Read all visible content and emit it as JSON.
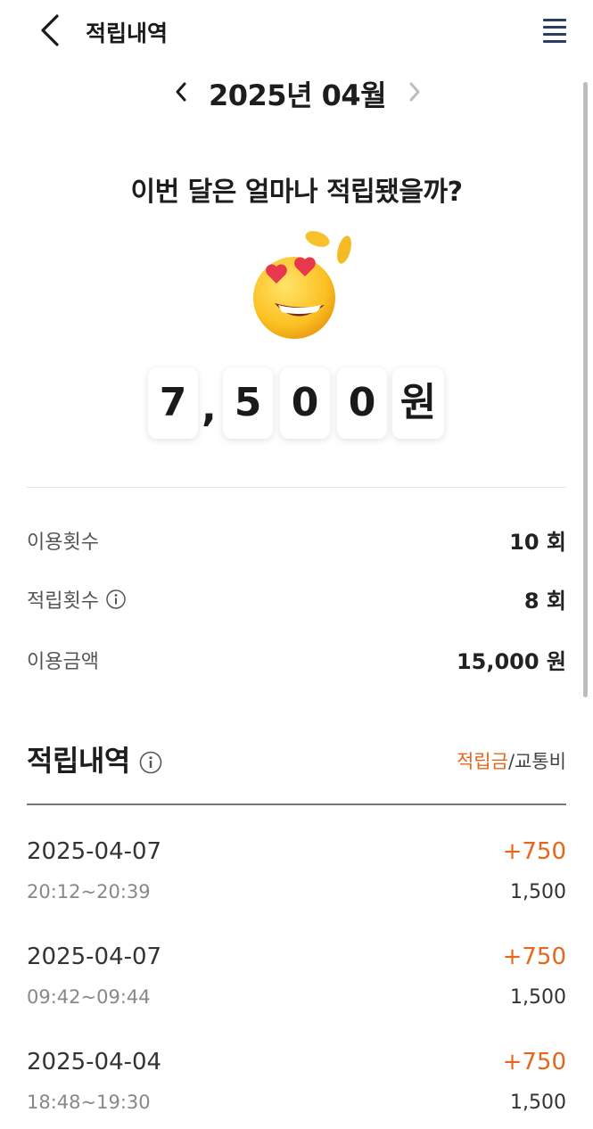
{
  "header": {
    "title": "적립내역",
    "back_icon": "chevron-left-icon",
    "menu_icon": "hamburger-menu-icon"
  },
  "month_nav": {
    "label": "2025년 04월",
    "prev_icon": "chevron-left-icon",
    "next_icon": "chevron-right-icon"
  },
  "summary": {
    "question": "이번 달은 얼마나 적립됐을까?",
    "emoji_icon": "heart-eyes-coins-emoji-icon",
    "amount_digits": [
      "7",
      ",",
      "5",
      "0",
      "0",
      "원"
    ]
  },
  "stats": [
    {
      "label": "이용횟수",
      "value": "10 회"
    },
    {
      "label": "적립횟수",
      "value": "8 회"
    },
    {
      "label": "이용금액",
      "value": "15,000 원"
    }
  ],
  "history": {
    "title": "적립내역",
    "toggle": {
      "active": "적립금",
      "separator": "/",
      "inactive": "교통비"
    },
    "records": [
      {
        "date": "2025-04-07",
        "time": "20:12~20:39",
        "points": "+750",
        "fare": "1,500"
      },
      {
        "date": "2025-04-07",
        "time": "09:42~09:44",
        "points": "+750",
        "fare": "1,500"
      },
      {
        "date": "2025-04-04",
        "time": "18:48~19:30",
        "points": "+750",
        "fare": "1,500"
      }
    ]
  },
  "colors": {
    "accent": "#e8661c",
    "menu": "#2b3a66"
  }
}
